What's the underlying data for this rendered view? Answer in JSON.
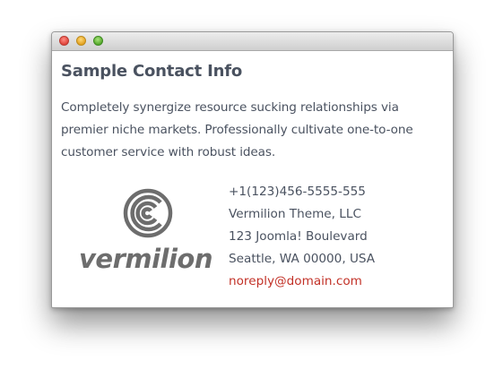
{
  "window": {
    "buttons": [
      "close",
      "minimize",
      "maximize"
    ]
  },
  "contact": {
    "title": "Sample Contact Info",
    "description": "Completely synergize resource sucking relationships via premier niche markets. Professionally cultivate one-to-one customer service with robust ideas.",
    "logo_text": "vermilion",
    "phone": "+1(123)456-5555-555",
    "company": "Vermilion Theme, LLC",
    "street": "123 Joomla! Boulevard",
    "city": "Seattle, WA 00000, USA",
    "email": "noreply@domain.com"
  },
  "colors": {
    "text": "#4a5260",
    "link": "#c23127",
    "logo": "#6d6d6d"
  }
}
